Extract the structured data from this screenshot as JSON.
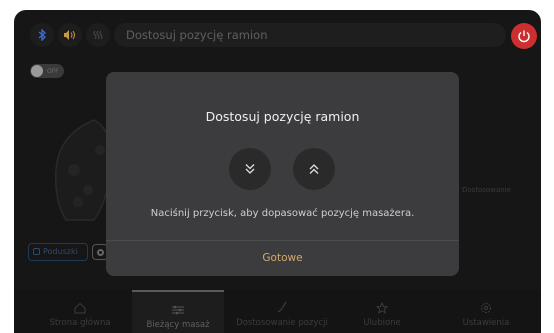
{
  "topbar": {
    "icons": [
      "bluetooth-icon",
      "speaker-icon",
      "heat-icon"
    ],
    "title": "Dostosuj pozycję ramion",
    "power_icon": "power-icon",
    "toggle_text": "OFF"
  },
  "background": {
    "side_label": "Dostosowanie",
    "cushion_label": "Poduszki"
  },
  "modal": {
    "title": "Dostosuj pozycję ramion",
    "down_icon": "double-chevron-down-icon",
    "up_icon": "double-chevron-up-icon",
    "message": "Naciśnij przycisk, aby dopasować pozycję masażera.",
    "done_label": "Gotowe"
  },
  "bottomnav": {
    "items": [
      {
        "label": "Strona główna",
        "icon": "home-icon"
      },
      {
        "label": "Bieżący masaż",
        "icon": "sliders-icon",
        "active": true
      },
      {
        "label": "Dostosowanie pozycji",
        "icon": "custom-icon"
      },
      {
        "label": "Ulubione",
        "icon": "star-icon"
      },
      {
        "label": "Ustawienia",
        "icon": "gear-icon"
      }
    ]
  },
  "colors": {
    "power": "#cc2f2f",
    "accent": "#d6a96a",
    "modal_bg": "#3c3c3e"
  }
}
